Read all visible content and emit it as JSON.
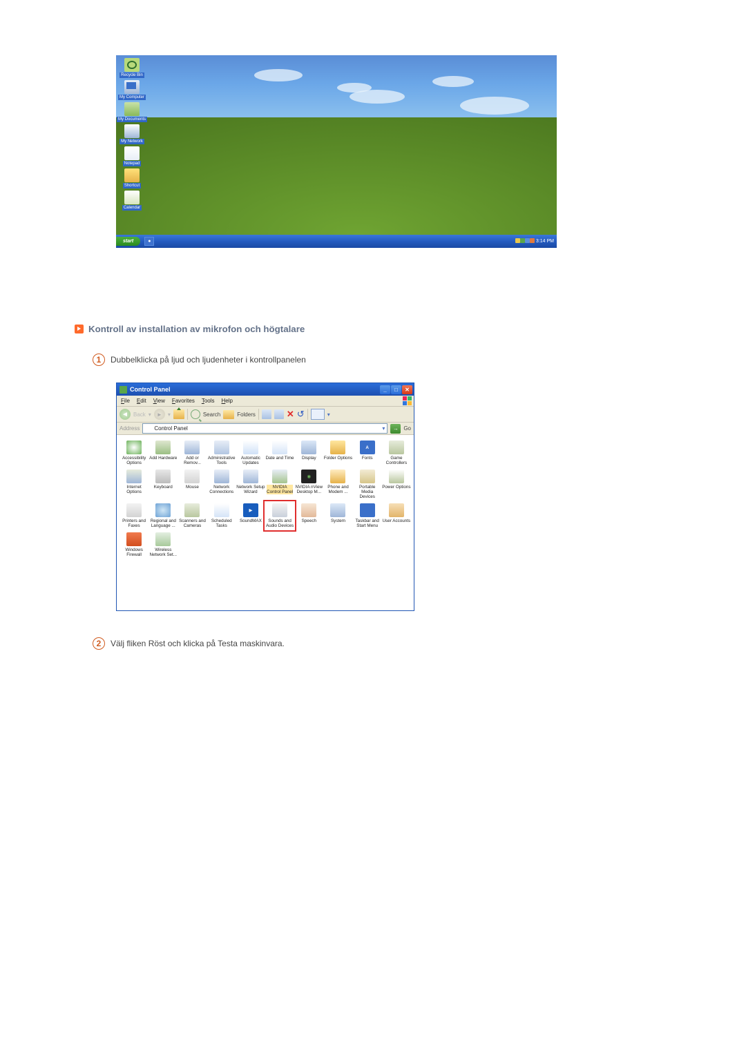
{
  "section_heading": "Kontroll av installation av mikrofon och högtalare",
  "steps": [
    {
      "num": "1",
      "text": "Dubbelklicka på ljud och ljudenheter i kontrollpanelen"
    },
    {
      "num": "2",
      "text": "Välj fliken Röst och klicka på Testa maskinvara."
    }
  ],
  "desktop": {
    "icons": [
      {
        "label": "Recycle Bin",
        "glyph": "g-recycle"
      },
      {
        "label": "My Computer",
        "glyph": "g-mycomp"
      },
      {
        "label": "My Documents",
        "glyph": "g-folder"
      },
      {
        "label": "My Network",
        "glyph": "g-net"
      },
      {
        "label": "Notepad",
        "glyph": "g-note"
      },
      {
        "label": "Shortcut",
        "glyph": "g-yellow"
      },
      {
        "label": "Calendar",
        "glyph": "g-cal"
      }
    ],
    "taskbar": {
      "start": "start",
      "browser_task": "●",
      "clock": "3:14 PM"
    }
  },
  "control_panel": {
    "title": "Control Panel",
    "menu": [
      "File",
      "Edit",
      "View",
      "Favorites",
      "Tools",
      "Help"
    ],
    "toolbar": {
      "back_label": "Back",
      "search_label": "Search",
      "folders_label": "Folders"
    },
    "address": {
      "label": "Address",
      "value": "Control Panel",
      "go": "Go"
    },
    "items": [
      {
        "label": "Accessibility\nOptions",
        "icon": "ic-access"
      },
      {
        "label": "Add Hardware",
        "icon": "ic-addhw"
      },
      {
        "label": "Add or\nRemov...",
        "icon": "ic-addrem"
      },
      {
        "label": "Administrative\nTools",
        "icon": "ic-admin"
      },
      {
        "label": "Automatic\nUpdates",
        "icon": "ic-autoup"
      },
      {
        "label": "Date and Time",
        "icon": "ic-date"
      },
      {
        "label": "Display",
        "icon": "ic-display"
      },
      {
        "label": "Folder Options",
        "icon": "ic-folderop"
      },
      {
        "label": "Fonts",
        "icon": "ic-fonts"
      },
      {
        "label": "Game\nControllers",
        "icon": "ic-game"
      },
      {
        "label": "Internet\nOptions",
        "icon": "ic-inet"
      },
      {
        "label": "Keyboard",
        "icon": "ic-kbd"
      },
      {
        "label": "Mouse",
        "icon": "ic-mouse"
      },
      {
        "label": "Network\nConnections",
        "icon": "ic-netconn"
      },
      {
        "label": "Network Setup\nWizard",
        "icon": "ic-netsetup"
      },
      {
        "label": "NVIDIA\nControl Panel",
        "icon": "ic-nvidia",
        "selected": true
      },
      {
        "label": "NVIDIA nView\nDesktop M...",
        "icon": "ic-nview"
      },
      {
        "label": "Phone and\nModem ...",
        "icon": "ic-phone"
      },
      {
        "label": "Portable Media\nDevices",
        "icon": "ic-portmedia"
      },
      {
        "label": "Power Options",
        "icon": "ic-power"
      },
      {
        "label": "Printers and\nFaxes",
        "icon": "ic-printers"
      },
      {
        "label": "Regional and\nLanguage ...",
        "icon": "ic-regional"
      },
      {
        "label": "Scanners and\nCameras",
        "icon": "ic-scanner"
      },
      {
        "label": "Scheduled\nTasks",
        "icon": "ic-sched"
      },
      {
        "label": "SoundMAX",
        "icon": "ic-soundmax"
      },
      {
        "label": "Sounds and\nAudio Devices",
        "icon": "ic-sounds",
        "highlight": true
      },
      {
        "label": "Speech",
        "icon": "ic-speech"
      },
      {
        "label": "System",
        "icon": "ic-system"
      },
      {
        "label": "Taskbar and\nStart Menu",
        "icon": "ic-taskbar"
      },
      {
        "label": "User Accounts",
        "icon": "ic-users"
      },
      {
        "label": "Windows\nFirewall",
        "icon": "ic-firewall"
      },
      {
        "label": "Wireless\nNetwork Set...",
        "icon": "ic-wireless"
      }
    ]
  }
}
